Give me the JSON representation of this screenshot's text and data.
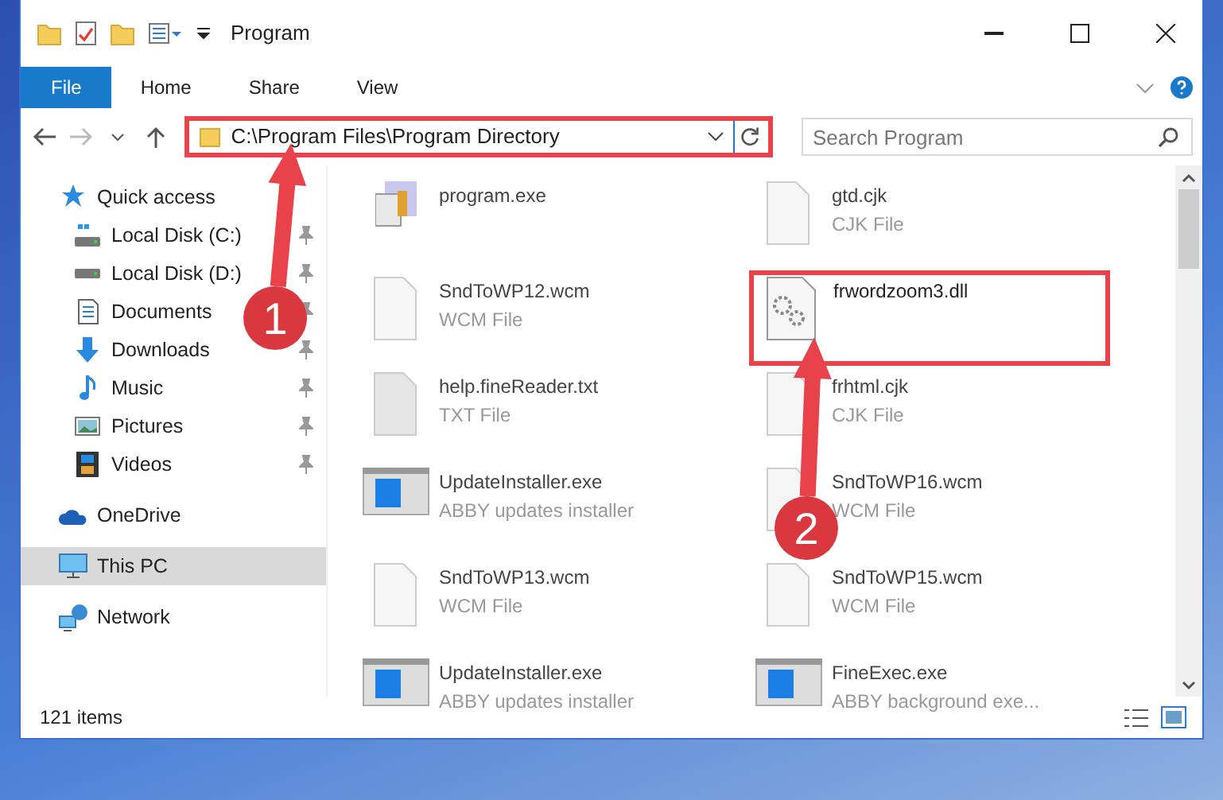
{
  "window": {
    "title": "Program"
  },
  "ribbon_tabs": [
    {
      "label": "File",
      "selected": true
    },
    {
      "label": "Home",
      "selected": false
    },
    {
      "label": "Share",
      "selected": false
    },
    {
      "label": "View",
      "selected": false
    }
  ],
  "address_bar": {
    "path": "C:\\Program Files\\Program Directory",
    "highlighted": true
  },
  "search": {
    "placeholder": "Search Program"
  },
  "sidebar": {
    "items": [
      {
        "label": "Quick access",
        "selected": false,
        "children": [
          {
            "label": "Local Disk (C:)",
            "pinned": true,
            "selected": false
          },
          {
            "label": "Local Disk (D:)",
            "pinned": true,
            "selected": false
          },
          {
            "label": "Documents",
            "pinned": true,
            "selected": false
          },
          {
            "label": "Downloads",
            "pinned": true,
            "selected": false
          },
          {
            "label": "Music",
            "pinned": true,
            "selected": false
          },
          {
            "label": "Pictures",
            "pinned": true,
            "selected": false
          },
          {
            "label": "Videos",
            "pinned": true,
            "selected": false
          }
        ]
      },
      {
        "label": "OneDrive",
        "selected": false
      },
      {
        "label": "This PC",
        "selected": true
      },
      {
        "label": "Network",
        "selected": false
      }
    ]
  },
  "files": [
    {
      "name": "program.exe",
      "kind": "exe",
      "highlighted": false
    },
    {
      "name": "gtd.cjk",
      "type": "CJK File",
      "kind": "blank",
      "highlighted": false
    },
    {
      "name": "SndToWP12.wcm",
      "type": "WCM File",
      "kind": "blank",
      "highlighted": false
    },
    {
      "name": "frwordzoom3.dll",
      "kind": "dll",
      "highlighted": true
    },
    {
      "name": "help.fineReader.txt",
      "type": "TXT File",
      "kind": "txt",
      "highlighted": false
    },
    {
      "name": "frhtml.cjk",
      "type": "CJK File",
      "kind": "blank",
      "highlighted": false
    },
    {
      "name": "UpdateInstaller.exe",
      "type": "ABBY updates installer",
      "kind": "installer",
      "highlighted": false
    },
    {
      "name": "SndToWP16.wcm",
      "type": "WCM File",
      "kind": "blank",
      "highlighted": false
    },
    {
      "name": "SndToWP13.wcm",
      "type": "WCM File",
      "kind": "blank",
      "highlighted": false
    },
    {
      "name": "SndToWP15.wcm",
      "type": "WCM File",
      "kind": "blank",
      "highlighted": false
    },
    {
      "name": "UpdateInstaller.exe",
      "type": "ABBY updates installer",
      "kind": "installer",
      "highlighted": false
    },
    {
      "name": "FineExec.exe",
      "type": "ABBY background exe...",
      "kind": "installer",
      "highlighted": false
    }
  ],
  "status_bar": {
    "item_count": "121 items"
  },
  "annotations": [
    {
      "number": "1"
    },
    {
      "number": "2"
    }
  ]
}
